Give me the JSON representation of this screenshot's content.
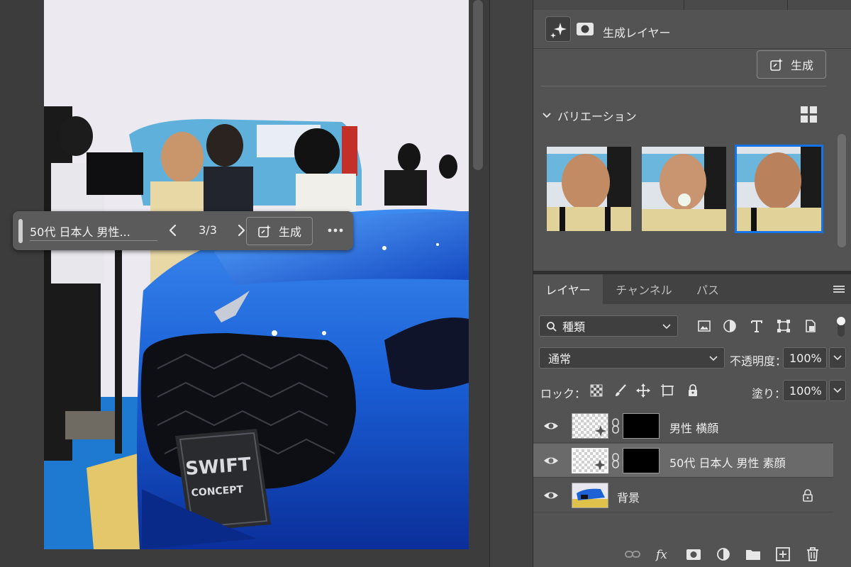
{
  "taskbar": {
    "prompt": "50代 日本人 男性...",
    "counter": "3/3",
    "generate_label": "生成"
  },
  "properties": {
    "layer_type_label": "生成レイヤー",
    "generate_label": "生成",
    "variations_title": "バリエーション",
    "selected_variation": 3
  },
  "layers_panel": {
    "tabs": [
      "レイヤー",
      "チャンネル",
      "パス"
    ],
    "filter_kind": "種類",
    "blend_mode": "通常",
    "opacity_label": "不透明度：",
    "opacity_value": "100%",
    "lock_label": "ロック：",
    "fill_label": "塗り：",
    "fill_value": "100%",
    "layers": [
      {
        "name": "男性 横顔",
        "selected": false,
        "locked": false
      },
      {
        "name": "50代 日本人 男性 素顔",
        "selected": true,
        "locked": false
      },
      {
        "name": "背景",
        "selected": false,
        "locked": true
      }
    ]
  },
  "colors": {
    "accent": "#1473e6",
    "panel_bg": "#535353",
    "car_blue": "#1e6ad8"
  }
}
